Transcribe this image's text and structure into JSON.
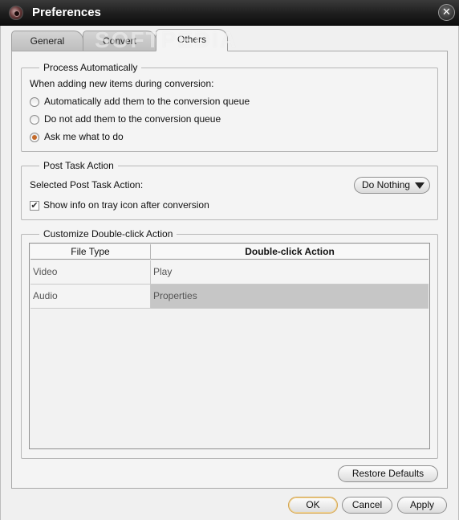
{
  "window": {
    "title": "Preferences",
    "close_glyph": "✕"
  },
  "tabs": [
    {
      "label": "General"
    },
    {
      "label": "Convert"
    },
    {
      "label": "Others"
    }
  ],
  "watermark": "SOFTPEDIA",
  "process_group": {
    "legend": "Process Automatically",
    "prompt": "When adding new items during conversion:",
    "options": [
      {
        "label": "Automatically add them to the conversion queue",
        "checked": false
      },
      {
        "label": "Do not add them to the conversion queue",
        "checked": false
      },
      {
        "label": "Ask me what to do",
        "checked": true
      }
    ]
  },
  "post_task_group": {
    "legend": "Post Task Action",
    "selected_label": "Selected Post Task Action:",
    "selected_value": "Do Nothing",
    "show_info_label": "Show info on tray icon after conversion",
    "show_info_checked": true,
    "check_glyph": "✔"
  },
  "double_click_group": {
    "legend": "Customize Double-click Action",
    "columns": [
      "File Type",
      "Double-click Action"
    ],
    "rows": [
      {
        "type": "Video",
        "action": "Play"
      },
      {
        "type": "Audio",
        "action": "Properties"
      }
    ]
  },
  "buttons": {
    "restore": "Restore Defaults",
    "ok": "OK",
    "cancel": "Cancel",
    "apply": "Apply"
  },
  "colors": {
    "titlebar": "#1e1e1e",
    "radio_accent": "#c46a2a",
    "ok_border": "#d3a24c"
  }
}
